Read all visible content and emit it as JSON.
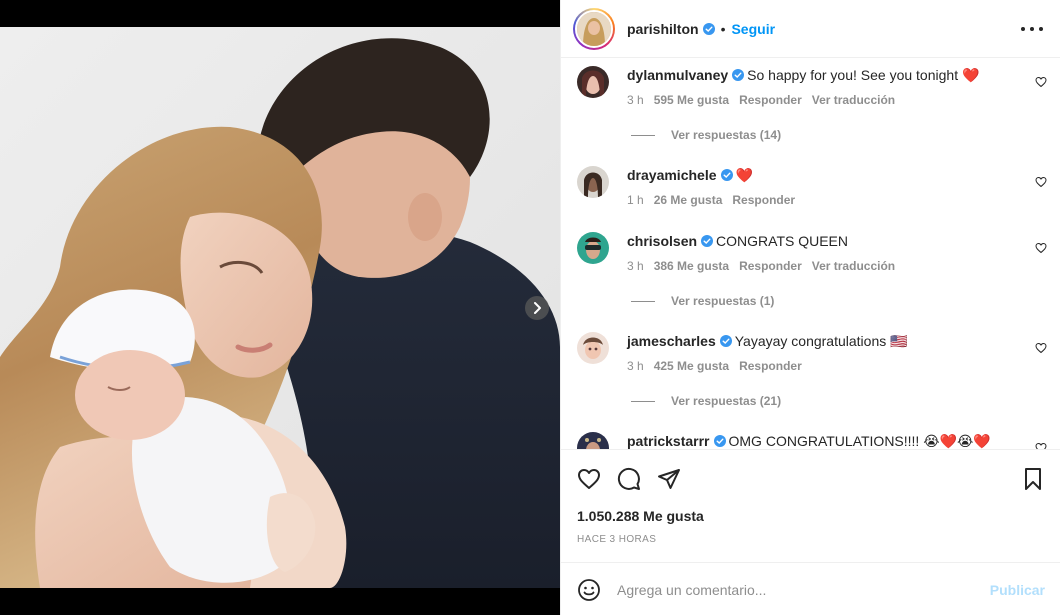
{
  "post": {
    "username": "parishilton",
    "separator": "•",
    "follow_label": "Seguir",
    "likes_count": "1.050.288 Me gusta",
    "time_ago": "HACE 3 HORAS"
  },
  "comments": [
    {
      "username": "dylanmulvaney",
      "text": "So happy for you! See you tonight ❤️",
      "time": "3 h",
      "likes": "595 Me gusta",
      "reply_label": "Responder",
      "translate_label": "Ver traducción",
      "view_replies": "Ver respuestas (14)",
      "avatar_color": "#5a3b33"
    },
    {
      "username": "drayamichele",
      "text": "❤️",
      "time": "1 h",
      "likes": "26 Me gusta",
      "reply_label": "Responder",
      "avatar_color": "#7a6a5c"
    },
    {
      "username": "chrisolsen",
      "text": "CONGRATS QUEEN",
      "time": "3 h",
      "likes": "386 Me gusta",
      "reply_label": "Responder",
      "translate_label": "Ver traducción",
      "view_replies": "Ver respuestas (1)",
      "avatar_color": "#2fa58f"
    },
    {
      "username": "jamescharles",
      "text": "Yayayay congratulations 🇺🇸",
      "time": "3 h",
      "likes": "425 Me gusta",
      "reply_label": "Responder",
      "view_replies": "Ver respuestas (21)",
      "avatar_color": "#c98c72"
    },
    {
      "username": "patrickstarrr",
      "text": "OMG CONGRATULATIONS!!!! 😭❤️😭❤️",
      "avatar_color": "#2a2f4a"
    }
  ],
  "add_comment": {
    "placeholder": "Agrega un comentario...",
    "publish_label": "Publicar"
  },
  "icons": {
    "like": "heart-icon",
    "comment": "comment-icon",
    "share": "paper-plane-icon",
    "save": "bookmark-icon",
    "more": "more-options-icon",
    "emoji": "emoji-icon",
    "next": "chevron-right-icon",
    "verified": "verified-badge-icon"
  },
  "colors": {
    "accent": "#0095f6",
    "verified": "#3897f0",
    "publish_disabled": "#b2dffc",
    "muted": "#8e8e8e"
  }
}
